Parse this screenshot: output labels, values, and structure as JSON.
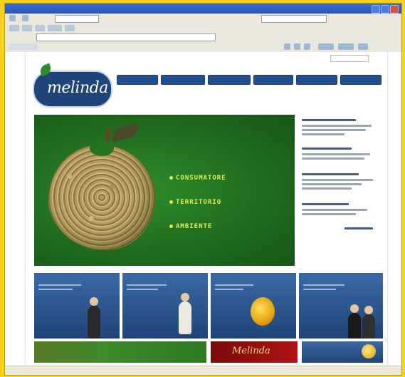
{
  "browser": {
    "title": "",
    "status_left": "",
    "status_right": ""
  },
  "page": {
    "top_links": "",
    "logo_word": "melinda",
    "logo_sub": "",
    "nav": [
      "",
      "",
      "",
      "",
      "",
      ""
    ],
    "hero_lines": [
      "CONSUMATORE",
      "TERRITORIO",
      "AMBIENTE"
    ],
    "side_link": "",
    "tiles": [
      {
        "title": "",
        "more": ""
      },
      {
        "title": "",
        "more": ""
      },
      {
        "title": "",
        "more": ""
      },
      {
        "title": "",
        "more": ""
      }
    ],
    "banner_brand": "Melinda",
    "banner_b3": ""
  },
  "colors": {
    "frame_bg": "#f5d21a",
    "brand_blue": "#1e4479",
    "hero_green": "#216d1f",
    "hero_text": "#e3ee48"
  }
}
